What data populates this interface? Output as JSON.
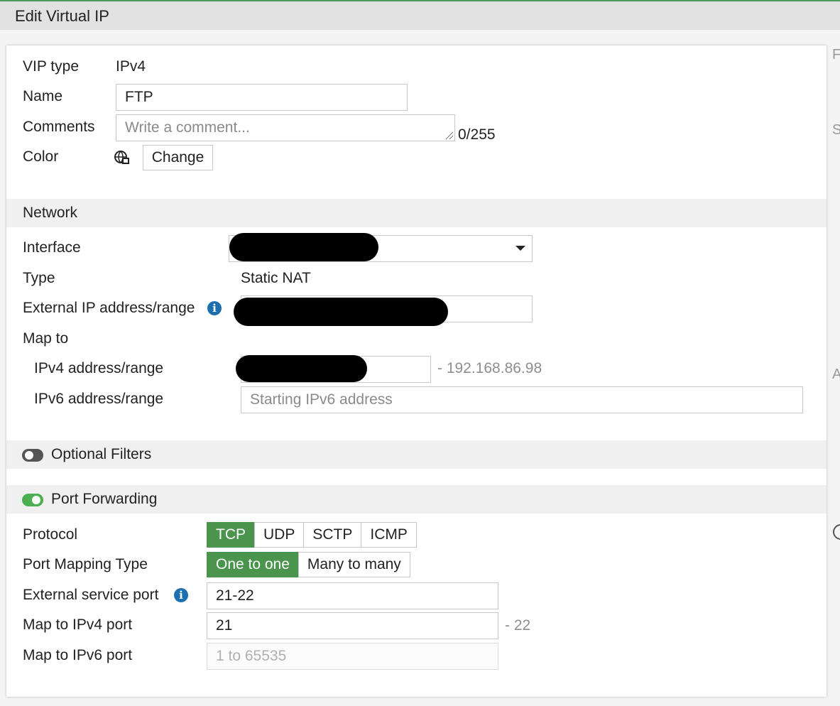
{
  "window": {
    "title": "Edit Virtual IP"
  },
  "right_fragments": [
    "F",
    "S",
    "A"
  ],
  "general": {
    "vip_type_label": "VIP type",
    "vip_type_value": "IPv4",
    "name_label": "Name",
    "name_value": "FTP",
    "comments_label": "Comments",
    "comments_placeholder": "Write a comment...",
    "comments_counter": "0/255",
    "color_label": "Color",
    "color_button": "Change"
  },
  "network": {
    "section_title": "Network",
    "interface_label": "Interface",
    "type_label": "Type",
    "type_value": "Static NAT",
    "external_ip_label": "External IP address/range",
    "map_to_label": "Map to",
    "ipv4_label": "IPv4 address/range",
    "ipv4_range_end": "- 192.168.86.98",
    "ipv6_label": "IPv6 address/range",
    "ipv6_placeholder": "Starting IPv6 address"
  },
  "optional_filters": {
    "title": "Optional Filters",
    "enabled": false
  },
  "port_forwarding": {
    "title": "Port Forwarding",
    "enabled": true,
    "protocol_label": "Protocol",
    "protocols": [
      "TCP",
      "UDP",
      "SCTP",
      "ICMP"
    ],
    "protocol_selected": "TCP",
    "mapping_type_label": "Port Mapping Type",
    "mapping_types": [
      "One to one",
      "Many to many"
    ],
    "mapping_selected": "One to one",
    "external_port_label": "External service port",
    "external_port_value": "21-22",
    "map_ipv4_port_label": "Map to IPv4 port",
    "map_ipv4_port_value": "21",
    "map_ipv4_port_end": "- 22",
    "map_ipv6_port_label": "Map to IPv6 port",
    "map_ipv6_port_placeholder": "1 to 65535"
  },
  "colors": {
    "accent_green": "#4a944e",
    "toggle_on": "#4caf50",
    "info_blue": "#1d6fb0",
    "header_border": "#4a9a5a"
  }
}
